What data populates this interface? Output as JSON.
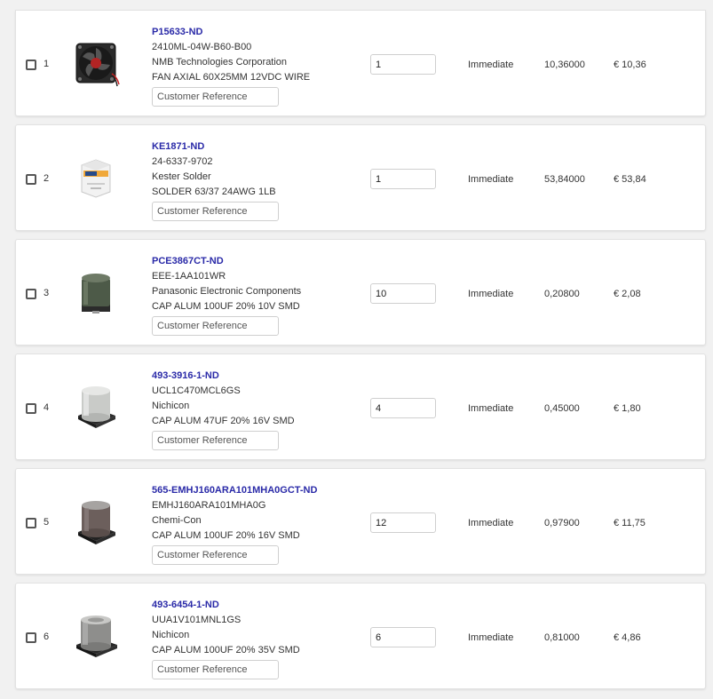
{
  "colors": {
    "part_link": "#2a2aa8",
    "background": "#f1f1f1",
    "card": "#ffffff"
  },
  "items": [
    {
      "index": "1",
      "part_number": "P15633-ND",
      "mfr_part": "2410ML-04W-B60-B00",
      "manufacturer": "NMB Technologies Corporation",
      "description": "FAN AXIAL 60X25MM 12VDC WIRE",
      "customer_reference_placeholder": "Customer Reference",
      "quantity": "1",
      "availability": "Immediate",
      "unit_price": "10,36000",
      "extended_price": "€ 10,36",
      "image_icon": "fan-image"
    },
    {
      "index": "2",
      "part_number": "KE1871-ND",
      "mfr_part": "24-6337-9702",
      "manufacturer": "Kester Solder",
      "description": "SOLDER 63/37 24AWG 1LB",
      "customer_reference_placeholder": "Customer Reference",
      "quantity": "1",
      "availability": "Immediate",
      "unit_price": "53,84000",
      "extended_price": "€ 53,84",
      "image_icon": "solder-spool-image"
    },
    {
      "index": "3",
      "part_number": "PCE3867CT-ND",
      "mfr_part": "EEE-1AA101WR",
      "manufacturer": "Panasonic Electronic Components",
      "description": "CAP ALUM 100UF 20% 10V SMD",
      "customer_reference_placeholder": "Customer Reference",
      "quantity": "10",
      "availability": "Immediate",
      "unit_price": "0,20800",
      "extended_price": "€ 2,08",
      "image_icon": "capacitor-image"
    },
    {
      "index": "4",
      "part_number": "493-3916-1-ND",
      "mfr_part": "UCL1C470MCL6GS",
      "manufacturer": "Nichicon",
      "description": "CAP ALUM 47UF 20% 16V SMD",
      "customer_reference_placeholder": "Customer Reference",
      "quantity": "4",
      "availability": "Immediate",
      "unit_price": "0,45000",
      "extended_price": "€ 1,80",
      "image_icon": "capacitor-image"
    },
    {
      "index": "5",
      "part_number": "565-EMHJ160ARA101MHA0GCT-ND",
      "mfr_part": "EMHJ160ARA101MHA0G",
      "manufacturer": "Chemi-Con",
      "description": "CAP ALUM 100UF 20% 16V SMD",
      "customer_reference_placeholder": "Customer Reference",
      "quantity": "12",
      "availability": "Immediate",
      "unit_price": "0,97900",
      "extended_price": "€ 11,75",
      "image_icon": "capacitor-image"
    },
    {
      "index": "6",
      "part_number": "493-6454-1-ND",
      "mfr_part": "UUA1V101MNL1GS",
      "manufacturer": "Nichicon",
      "description": "CAP ALUM 100UF 20% 35V SMD",
      "customer_reference_placeholder": "Customer Reference",
      "quantity": "6",
      "availability": "Immediate",
      "unit_price": "0,81000",
      "extended_price": "€ 4,86",
      "image_icon": "capacitor-image"
    }
  ]
}
